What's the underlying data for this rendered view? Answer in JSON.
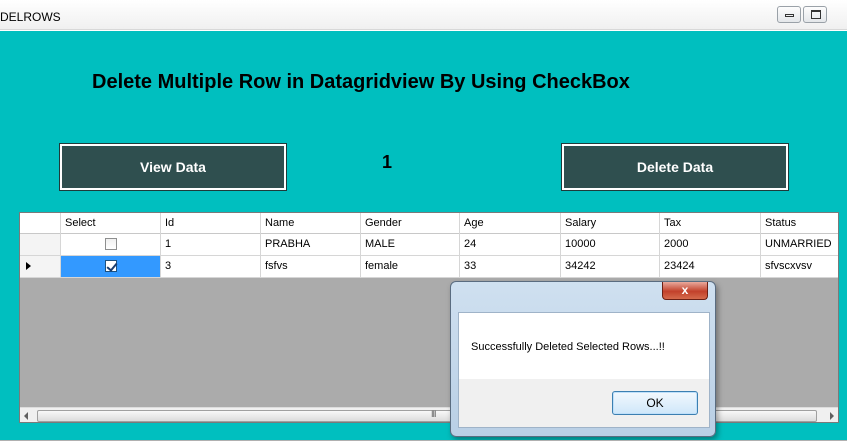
{
  "window": {
    "title": "DELROWS"
  },
  "form": {
    "heading": "Delete Multiple Row in Datagridview By Using CheckBox",
    "view_button": "View Data",
    "delete_button": "Delete Data",
    "counter": "1",
    "background_color": "#00bfbf",
    "button_color": "#2f4f4f"
  },
  "grid": {
    "columns": [
      "Select",
      "Id",
      "Name",
      "Gender",
      "Age",
      "Salary",
      "Tax",
      "Status"
    ],
    "rows": [
      {
        "checked": false,
        "current": false,
        "Id": "1",
        "Name": "PRABHA",
        "Gender": "MALE",
        "Age": "24",
        "Salary": "10000",
        "Tax": "2000",
        "Status": "UNMARRIED"
      },
      {
        "checked": true,
        "current": true,
        "Id": "3",
        "Name": "fsfvs",
        "Gender": "female",
        "Age": "33",
        "Salary": "34242",
        "Tax": "23424",
        "Status": "sfvscxvsv"
      }
    ],
    "scrollbar_grip": "III"
  },
  "messagebox": {
    "close_glyph": "x",
    "message": "Successfully Deleted Selected Rows...!!",
    "ok_label": "OK"
  }
}
